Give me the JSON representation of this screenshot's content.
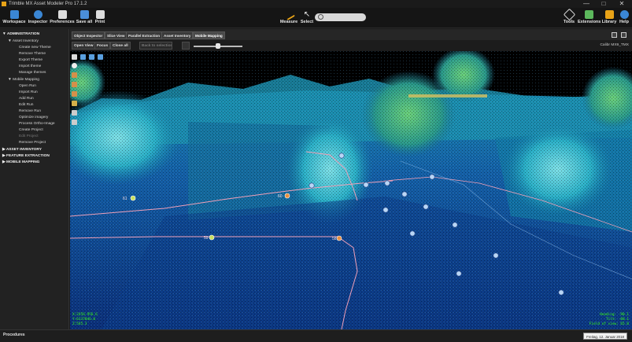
{
  "window": {
    "title": "Trimble MX Asset Modeler Pro 17.1.2",
    "minimize": "—",
    "maximize": "□",
    "close": "✕"
  },
  "toolbar": {
    "workspace": "Workspace",
    "inspector": "Inspector",
    "preferences": "Preferences",
    "save_all": "Save all",
    "print": "Print",
    "measure": "Measure",
    "select": "Select",
    "search_placeholder": "",
    "tools": "Tools",
    "extensions": "Extensions",
    "library": "Library",
    "help": "Help"
  },
  "sidebar": {
    "items": [
      {
        "label": "▼ ADMINISTRATION",
        "level": 0,
        "bold": true
      },
      {
        "label": "▼ Asset Inventory",
        "level": 1
      },
      {
        "label": "Create new Theme",
        "level": 2
      },
      {
        "label": "Remove Theme",
        "level": 2
      },
      {
        "label": "Export Theme",
        "level": 2
      },
      {
        "label": "Import theme",
        "level": 2
      },
      {
        "label": "Manage themes",
        "level": 2
      },
      {
        "label": "▼ Mobile Mapping",
        "level": 1
      },
      {
        "label": "Open Run",
        "level": 2
      },
      {
        "label": "Import Run",
        "level": 2
      },
      {
        "label": "Add Run",
        "level": 2
      },
      {
        "label": "Edit Run",
        "level": 2
      },
      {
        "label": "Remove Run",
        "level": 2
      },
      {
        "label": "Optimize imagery",
        "level": 2
      },
      {
        "label": "Process Ortho-Image",
        "level": 2
      },
      {
        "label": "Create Project",
        "level": 2
      },
      {
        "label": "Edit Project",
        "level": 2,
        "disabled": true
      },
      {
        "label": "Remove Project",
        "level": 2
      },
      {
        "label": "▶ ASSET INVENTORY",
        "level": 0,
        "bold": true
      },
      {
        "label": "▶ FEATURE EXTRACTION",
        "level": 0,
        "bold": true
      },
      {
        "label": "▶ MOBILE MAPPING",
        "level": 0,
        "bold": true
      }
    ]
  },
  "tabs": [
    {
      "label": "Object Inspector"
    },
    {
      "label": "Slice View"
    },
    {
      "label": "Parallel Extraction"
    },
    {
      "label": "Asset Inventory"
    },
    {
      "label": "Mobile Mapping",
      "active": true
    }
  ],
  "viewer": {
    "open_view": "Open View",
    "focus": "Focus",
    "close_all": "Close all",
    "disabled_btn": "Back to selection",
    "calibration": "Calibr MX9_TMX",
    "slider_value": 0.5
  },
  "overlay": {
    "coords": [
      "X:2456.956.6",
      "Y:6137046.0",
      "Z:545.3"
    ],
    "nav": [
      "Heading: -90.1",
      "Tilt: -88.1",
      "Field of view: 65.0"
    ]
  },
  "markers": [
    {
      "label": "61"
    },
    {
      "label": "60"
    },
    {
      "label": "59"
    },
    {
      "label": "58"
    }
  ],
  "status": {
    "left": "Procedures",
    "date": "Freitag, 12. Januar 2018"
  },
  "colors": {
    "accent": "#e8a317",
    "overlay_text": "#39ff14",
    "trajectory": "#f0a0b8"
  }
}
